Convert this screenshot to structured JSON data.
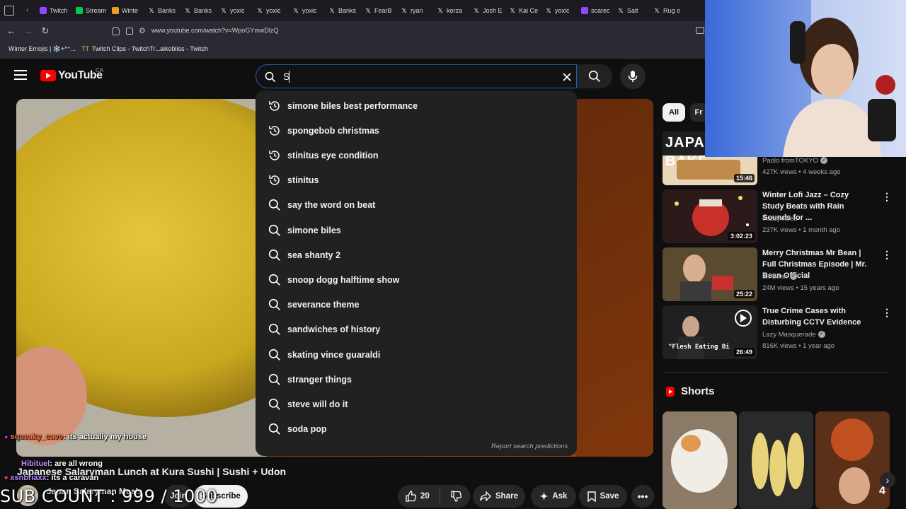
{
  "browser": {
    "tabs": [
      "Twitch",
      "Stream",
      "Winte",
      "Banks",
      "Banks",
      "yoxic",
      "yoxic",
      "yoxic",
      "Banks",
      "FearB",
      "ryan",
      "korza",
      "Josh E",
      "Kai Ce",
      "yoxic",
      "scarec",
      "Salt",
      "Rug o"
    ],
    "url": "www.youtube.com/watch?v=WpoGYmwDlzQ",
    "bookmarks": [
      "Winter Emojis | ❄️+*⁺...",
      "Twitch Clips - TwitchTr...",
      "aikobliss - Twitch"
    ]
  },
  "header": {
    "logo_text": "YouTube",
    "country": "CA",
    "search_value": "S"
  },
  "suggestions": [
    {
      "text": "simone biles best performance",
      "icon": "history-icon"
    },
    {
      "text": "spongebob christmas",
      "icon": "history-icon"
    },
    {
      "text": "stinitus eye condition",
      "icon": "history-icon"
    },
    {
      "text": "stinitus",
      "icon": "history-icon"
    },
    {
      "text": "say the word on beat",
      "icon": "search-icon"
    },
    {
      "text": "simone biles",
      "icon": "search-icon"
    },
    {
      "text": "sea shanty 2",
      "icon": "search-icon"
    },
    {
      "text": "snoop dogg halftime show",
      "icon": "search-icon"
    },
    {
      "text": "severance theme",
      "icon": "search-icon"
    },
    {
      "text": "sandwiches of history",
      "icon": "search-icon"
    },
    {
      "text": "skating vince guaraldi",
      "icon": "search-icon"
    },
    {
      "text": "stranger things",
      "icon": "search-icon"
    },
    {
      "text": "steve will do it",
      "icon": "search-icon"
    },
    {
      "text": "soda pop",
      "icon": "search-icon"
    }
  ],
  "report_link": "Report search predictions",
  "chat": [
    {
      "user": "squeaky_cave",
      "msg": "its actually my house"
    },
    {
      "user": "Hibituel",
      "msg": "are all wrong"
    },
    {
      "user": "xsnbriaxx",
      "msg": "its a caravan"
    }
  ],
  "video": {
    "title": "Japanese Salaryman Lunch at Kura Sushi | Sushi + Udon",
    "channel": "Japan Salaryman Meals",
    "sub_overlay": "SUB COUNT : 999 / 1000",
    "subscribe_label": "Subscribe",
    "join_label": "Join",
    "likes": "20",
    "share_label": "Share",
    "ask_label": "Ask",
    "save_label": "Save"
  },
  "chips": {
    "all": "All",
    "from": "Fr"
  },
  "recommendations": [
    {
      "title": "",
      "channel": "Paolo fromTOKYO",
      "meta": "427K views • 4 weeks ago",
      "duration": "15:46",
      "verified": true,
      "thumb_text": "JAPANESE BAKE"
    },
    {
      "title": "Winter Lofi Jazz – Cozy Study Beats with Rain Sounds for ...",
      "channel": "FuzzyVibes",
      "meta": "237K views • 1 month ago",
      "duration": "3:02:23",
      "verified": false
    },
    {
      "title": "Merry Christmas Mr Bean | Full Christmas Episode | Mr. Bean Official",
      "channel": "Mr Bean",
      "meta": "24M views • 15 years ago",
      "duration": "25:22",
      "verified": true
    },
    {
      "title": "True Crime Cases with Disturbing CCTV Evidence",
      "channel": "Lazy Masquerade",
      "meta": "816K views • 1 year ago",
      "duration": "26:49",
      "verified": true,
      "thumb_text": "\"Flesh Eating Bi"
    }
  ],
  "shorts": {
    "label": "Shorts",
    "badge": "4"
  },
  "colors": {
    "accent": "#ff0000",
    "bg": "#0f0f0f",
    "search_focus": "#1c62b9"
  }
}
